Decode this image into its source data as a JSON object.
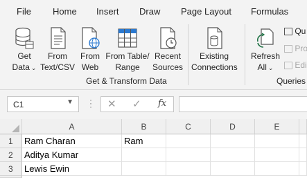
{
  "menu": {
    "tabs": [
      "File",
      "Home",
      "Insert",
      "Draw",
      "Page Layout",
      "Formulas"
    ]
  },
  "ribbon": {
    "get_transform": {
      "group_label": "Get & Transform Data",
      "get_data": {
        "line1": "Get",
        "line2": "Data"
      },
      "from_text_csv": {
        "line1": "From",
        "line2": "Text/CSV"
      },
      "from_web": {
        "line1": "From",
        "line2": "Web"
      },
      "from_table_range": {
        "line1": "From Table/",
        "line2": "Range"
      },
      "recent_sources": {
        "line1": "Recent",
        "line2": "Sources"
      },
      "existing_connections": {
        "line1": "Existing",
        "line2": "Connections"
      }
    },
    "queries": {
      "group_label": "Queries &",
      "refresh_all": {
        "line1": "Refresh",
        "line2": "All"
      },
      "queries_label": "Qu",
      "properties_label": "Pro",
      "edit_links_label": "Edi"
    }
  },
  "formula_bar": {
    "name_box": "C1",
    "formula_value": ""
  },
  "sheet": {
    "columns": [
      "A",
      "B",
      "C",
      "D",
      "E"
    ],
    "rows": [
      {
        "num": "1",
        "cells": [
          "Ram Charan",
          "Ram",
          "",
          "",
          ""
        ]
      },
      {
        "num": "2",
        "cells": [
          "Aditya Kumar",
          "",
          "",
          "",
          ""
        ]
      },
      {
        "num": "3",
        "cells": [
          "Lewis Ewin",
          "",
          "",
          "",
          ""
        ]
      }
    ]
  },
  "colors": {
    "ribbon_bg": "#f3f3f3",
    "excel_green": "#217346",
    "icon_blue": "#2b79d0"
  }
}
